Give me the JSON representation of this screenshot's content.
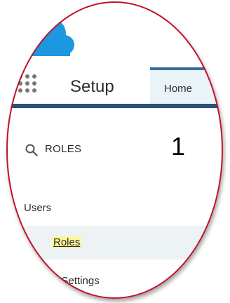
{
  "header": {
    "app_title": "Setup",
    "home_tab": "Home"
  },
  "search": {
    "value": "ROLES"
  },
  "annotation": {
    "step_number": "1"
  },
  "nav": {
    "users": "Users",
    "roles": "Roles",
    "settings": "re Settings"
  },
  "colors": {
    "brand_cloud": "#1b98e0",
    "header_border": "#2b5278",
    "highlight": "#fbf79a",
    "lens_ring": "#c0122a",
    "selected_row": "#edf2f5"
  },
  "icons": {
    "launcher": "app-launcher-grid-icon",
    "search": "search-icon",
    "logo": "salesforce-cloud-logo"
  }
}
